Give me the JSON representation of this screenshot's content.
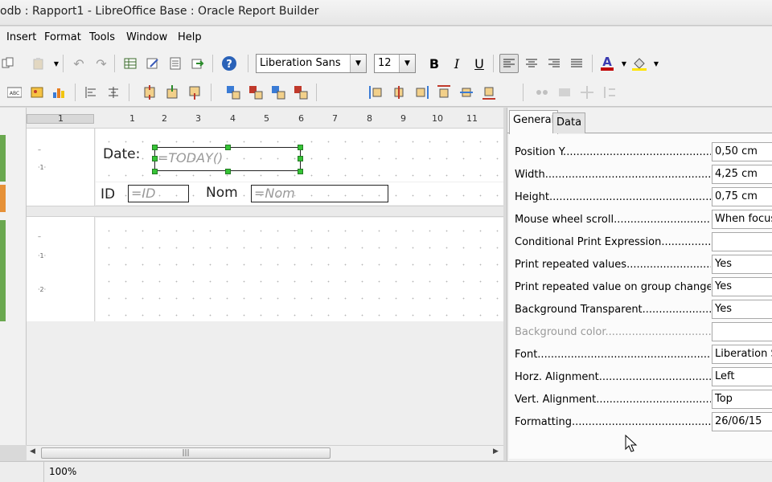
{
  "window": {
    "title": "odb : Rapport1 - LibreOffice Base : Oracle Report Builder"
  },
  "menu": [
    "Insert",
    "Format",
    "Tools",
    "Window",
    "Help"
  ],
  "toolbar": {
    "font_name": "Liberation Sans",
    "font_size": "12",
    "bold": "B",
    "italic": "I",
    "underline": "U"
  },
  "ruler": {
    "numbers": [
      "1",
      "1",
      "2",
      "3",
      "4",
      "5",
      "6",
      "7",
      "8",
      "9",
      "10",
      "11"
    ]
  },
  "report": {
    "date_label": "Date:",
    "date_field": "=TODAY()",
    "id_label": "ID",
    "id_field": "=ID",
    "nom_label": "Nom",
    "nom_field": "=Nom"
  },
  "properties": {
    "tabs": [
      "General",
      "Data"
    ],
    "rows": [
      {
        "label": "Position Y............................................................",
        "value": "0,50 cm",
        "disabled": false
      },
      {
        "label": "Width.................................................................................",
        "value": "4,25 cm",
        "disabled": false
      },
      {
        "label": "Height...............................................................................",
        "value": "0,75 cm",
        "disabled": false
      },
      {
        "label": "Mouse wheel scroll..................................................",
        "value": "When focused",
        "disabled": false
      },
      {
        "label": "Conditional Print Expression.........................................",
        "value": "",
        "disabled": false
      },
      {
        "label": "Print repeated values...................................................",
        "value": "Yes",
        "disabled": false
      },
      {
        "label": "Print repeated value on group change.........................",
        "value": "Yes",
        "disabled": false
      },
      {
        "label": "Background Transparent.............................................",
        "value": "Yes",
        "disabled": false
      },
      {
        "label": "Background color.......................................................",
        "value": "",
        "disabled": true
      },
      {
        "label": "Font...................................................................................",
        "value": "Liberation Sans",
        "disabled": false
      },
      {
        "label": "Horz. Alignment............................................................",
        "value": "Left",
        "disabled": false
      },
      {
        "label": "Vert. Alignment.............................................................",
        "value": "Top",
        "disabled": false
      },
      {
        "label": "Formatting.....................................................................",
        "value": "26/06/15",
        "disabled": false
      }
    ]
  },
  "status": {
    "zoom": "100%"
  },
  "icons": {
    "toolbar1": [
      "copy-icon",
      "paste-icon",
      "undo-icon",
      "redo-icon",
      "table-icon",
      "edit-icon",
      "report-icon",
      "import-icon",
      "help-icon"
    ],
    "toolbar2": [
      "label-icon",
      "image-icon",
      "chart-icon",
      "align-left-edge-icon",
      "align-center-icon",
      "shrink-icon",
      "shrink-top-icon",
      "shrink-bottom-icon",
      "resize-icon",
      "resize-icon",
      "resize-icon",
      "resize-icon",
      "move-left-icon",
      "move-center-icon",
      "move-right-icon",
      "move-top-icon",
      "move-middle-icon",
      "move-bottom-icon"
    ]
  },
  "colors": {
    "selection_handle": "#36c336",
    "section_green": "#6aa84f",
    "section_orange": "#e69138",
    "help_blue": "#2a62b8"
  }
}
